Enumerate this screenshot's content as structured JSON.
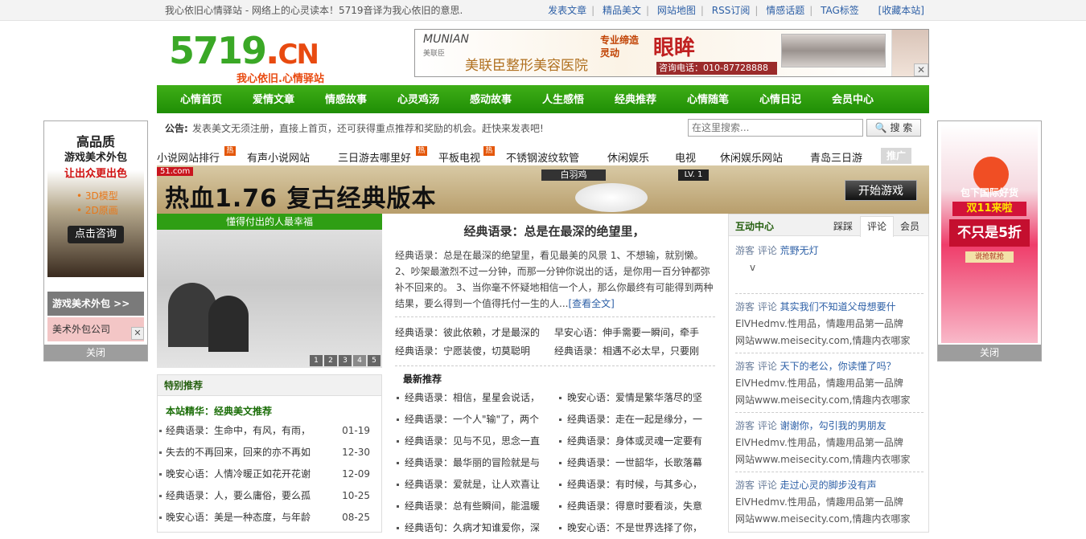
{
  "topbar": {
    "slogan": "我心依旧心情驿站 - 网络上的心灵读本！5719音译为我心依旧的意思.",
    "links": [
      "发表文章",
      "精品美文",
      "网站地图",
      "RSS订阅",
      "情感话题",
      "TAG标签"
    ],
    "bookmark": "[收藏本站]"
  },
  "logo": {
    "digits": "5719",
    "dot": ".",
    "tld": "CN",
    "tagline": "我心依旧.心情驿站"
  },
  "banner_ad": {
    "brand_en": "MUNIAN",
    "brand_cn": "美联臣",
    "hospital": "美联臣整形美容医院",
    "line1": "专业缔造",
    "line2": "灵动",
    "big": "眼眸",
    "tel": "咨询电话：010-87728888",
    "close": "✕"
  },
  "nav": [
    "心情首页",
    "爱情文章",
    "情感故事",
    "心灵鸡汤",
    "感动故事",
    "人生感悟",
    "经典推荐",
    "心情随笔",
    "心情日记",
    "会员中心"
  ],
  "notice": {
    "label": "公告:",
    "message": "发表美文无须注册，直接上首页，还可获得重点推荐和奖励的机会。赶快来发表吧!",
    "search_placeholder": "在这里搜索...",
    "search_button": "搜 索"
  },
  "hotlinks": {
    "items": [
      "小说网站排行",
      "有声小说网站",
      "三日游去哪里好",
      "平板电视",
      "不锈钢波纹软管",
      "休闲娱乐",
      "电视",
      "休闲娱乐网站",
      "青岛三日游"
    ],
    "hot_badge": "热",
    "tag": "推广"
  },
  "game_ad": {
    "site": "51.com",
    "title": "热血1.76 复古经典版本",
    "enemy": "白羽鸡",
    "level": "LV. 1",
    "button": "开始游戏"
  },
  "slider": {
    "caption": "懂得付出的人最幸福",
    "pages": [
      "1",
      "2",
      "3",
      "4",
      "5"
    ]
  },
  "special": {
    "header": "特别推荐",
    "featured": "本站精华：经典美文推荐",
    "items": [
      {
        "title": "经典语录：生命中，有风，有雨，",
        "date": "01-19"
      },
      {
        "title": "失去的不再回来，回来的亦不再如",
        "date": "12-30"
      },
      {
        "title": "晚安心语：人情冷暖正如花开花谢",
        "date": "12-09"
      },
      {
        "title": "经典语录：人，要么庸俗，要么孤",
        "date": "10-25"
      },
      {
        "title": "晚安心语：美是一种态度，与年龄",
        "date": "08-25"
      }
    ]
  },
  "article": {
    "title": "经典语录：总是在最深的绝望里，",
    "summary": "经典语录：总是在最深的绝望里，看见最美的风景 1、不想输，就别懒。 2、吵架最激烈不过一分钟，而那一分钟你说出的话，是你用一百分钟都弥补不回来的。 3、当你毫不怀疑地相信一个人，那么你最终有可能得到两种结果，要么得到一个值得托付一生的人...",
    "more": "[查看全文]",
    "pairs": [
      [
        "经典语录：彼此依赖，才是最深的",
        "早安心语：伸手需要一瞬间，牵手"
      ],
      [
        "经典语录：宁愿装傻，切莫聪明",
        "经典语录：相遇不必太早，只要刚"
      ]
    ]
  },
  "latest": {
    "header": "最新推荐",
    "items": [
      "经典语录：相信，星星会说话，",
      "晚安心语：爱情是繁华落尽的坚",
      "经典语录：一个人\"输\"了，两个",
      "经典语录：走在一起是缘分，一",
      "经典语录：见与不见，思念一直",
      "经典语录：身体或灵魂一定要有",
      "经典语录：最华丽的冒险就是与",
      "经典语录：一世韶华，长歌落幕",
      "经典语录：爱就是，让人欢喜让",
      "经典语录：有时候，与其多心，",
      "经典语录：总有些瞬间，能温暖",
      "经典语录：得意时要看淡，失意",
      "经典语句：久病才知谁爱你，深",
      "晚安心语：不是世界选择了你，"
    ]
  },
  "interaction": {
    "title": "互动中心",
    "tabs": [
      "踩踩",
      "评论",
      "会员"
    ],
    "items": [
      {
        "who": "游客 评论",
        "link": "荒野无灯",
        "body": [
          "v"
        ]
      },
      {
        "who": "游客 评论",
        "link": "其实我们不知道父母想要什",
        "body": [
          "ElVHedmv.性用品，情趣用品第一品牌",
          "网站www.meisecity.com,情趣内衣哪家"
        ]
      },
      {
        "who": "游客 评论",
        "link": "天下的老公，你读懂了吗？",
        "body": [
          "ElVHedmv.性用品，情趣用品第一品牌",
          "网站www.meisecity.com,情趣内衣哪家"
        ]
      },
      {
        "who": "游客 评论",
        "link": "谢谢你，勾引我的男朋友",
        "body": [
          "ElVHedmv.性用品，情趣用品第一品牌",
          "网站www.meisecity.com,情趣内衣哪家"
        ]
      },
      {
        "who": "游客 评论",
        "link": "走过心灵的脚步没有声",
        "body": [
          "ElVHedmv.性用品，情趣用品第一品牌",
          "网站www.meisecity.com,情趣内衣哪家"
        ]
      }
    ]
  },
  "float_left": {
    "t1": "高品质",
    "t2": "游戏美术外包",
    "t3": "让出众更出色",
    "t4": "• 3D模型",
    "t5": "• 2D原画",
    "button": "点击咨询",
    "bar1": "游戏美术外包 >>",
    "bar2": "美术外包公司",
    "close_x": "✕",
    "close": "关闭"
  },
  "float_right": {
    "t1": "双11来啦",
    "t2": "包下国际好货",
    "t3": "不只是5折",
    "t4": "说抢就抢",
    "close": "关闭"
  },
  "colors": {
    "green": "#2f9e14",
    "link_blue": "#2c5fa6",
    "hot_orange": "#e4570a"
  }
}
